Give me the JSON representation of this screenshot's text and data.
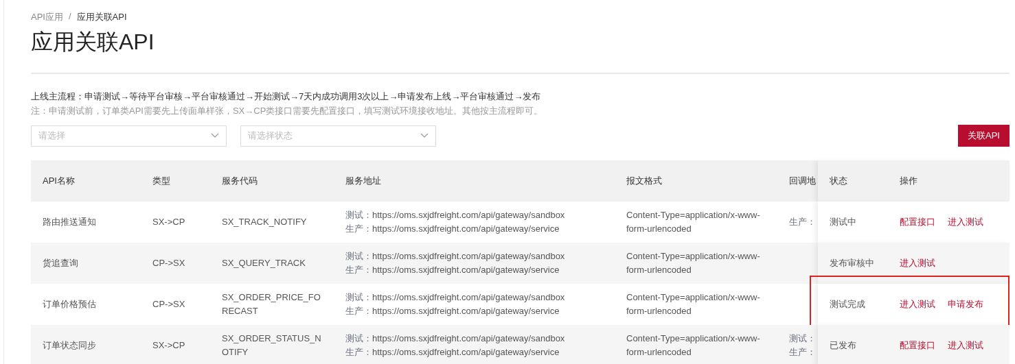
{
  "breadcrumb": {
    "items": [
      {
        "label": "API应用"
      },
      {
        "label": "应用关联API"
      }
    ],
    "separator": "/"
  },
  "title": "应用关联API",
  "flow_text": "上线主流程：申请测试→等待平台审核→平台审核通过→开始测试→7天内成功调用3次以上→申请发布上线→平台审核通过→发布",
  "note": "注：申请测试前，订单类API需要先上传面单样张，SX→CP类接口需要先配置接口，填写测试环境接收地址。其他按主流程即可。",
  "filters": [
    {
      "placeholder": "请选择"
    },
    {
      "placeholder": "请选择状态"
    }
  ],
  "link_api_button": "关联API",
  "table": {
    "columns": [
      "API名称",
      "类型",
      "服务代码",
      "服务地址",
      "报文格式",
      "回调地"
    ],
    "fixed_columns": [
      "状态",
      "操作"
    ],
    "rows": [
      {
        "name": "路由推送通知",
        "type": "SX->CP",
        "code": "SX_TRACK_NOTIFY",
        "address": [
          {
            "label": "测试：",
            "url": "https://oms.sxjdfreight.com/api/gateway/sandbox"
          },
          {
            "label": "生产：",
            "url": "https://oms.sxjdfreight.com/api/gateway/service"
          }
        ],
        "format": "Content-Type=application/x-www-form-urlencoded",
        "callback": [
          "生产："
        ],
        "status": "测试中",
        "actions": [
          "配置接口",
          "进入测试"
        ],
        "highlighted": false
      },
      {
        "name": "货追查询",
        "type": "CP->SX",
        "code": "SX_QUERY_TRACK",
        "address": [
          {
            "label": "测试：",
            "url": "https://oms.sxjdfreight.com/api/gateway/sandbox"
          },
          {
            "label": "生产：",
            "url": "https://oms.sxjdfreight.com/api/gateway/service"
          }
        ],
        "format": "Content-Type=application/x-www-form-urlencoded",
        "status": "发布审核中",
        "actions": [
          "进入测试"
        ],
        "highlighted": false
      },
      {
        "name": "订单价格预估",
        "type": "CP->SX",
        "code": "SX_ORDER_PRICE_FORECAST",
        "address": [
          {
            "label": "测试：",
            "url": "https://oms.sxjdfreight.com/api/gateway/sandbox"
          },
          {
            "label": "生产：",
            "url": "https://oms.sxjdfreight.com/api/gateway/service"
          }
        ],
        "format": "Content-Type=application/x-www-form-urlencoded",
        "status": "测试完成",
        "actions": [
          "进入测试",
          "申请发布"
        ],
        "highlighted": true
      },
      {
        "name": "订单状态同步",
        "type": "SX->CP",
        "code": "SX_ORDER_STATUS_NOTIFY",
        "address": [
          {
            "label": "测试：",
            "url": "https://oms.sxjdfreight.com/api/gateway/sandbox"
          },
          {
            "label": "生产：",
            "url": "https://oms.sxjdfreight.com/api/gateway/service"
          }
        ],
        "format": "Content-Type=application/x-www-form-urlencoded",
        "callback": [
          "测试：",
          "生产："
        ],
        "status": "已发布",
        "actions": [
          "配置接口",
          "进入测试"
        ],
        "highlighted": false
      }
    ]
  }
}
